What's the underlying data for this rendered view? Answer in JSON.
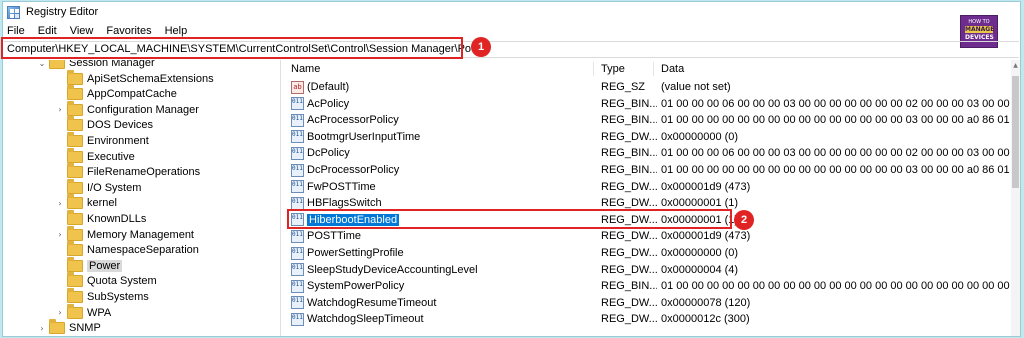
{
  "window": {
    "title": "Registry Editor"
  },
  "menu": [
    "File",
    "Edit",
    "View",
    "Favorites",
    "Help"
  ],
  "address": "Computer\\HKEY_LOCAL_MACHINE\\SYSTEM\\CurrentControlSet\\Control\\Session Manager\\Power",
  "logo": {
    "line1": "HOW TO",
    "line2": "MANAGE",
    "line3": "DEVICES"
  },
  "callouts": [
    "1",
    "2"
  ],
  "tree": [
    {
      "label": "Session Manager",
      "chevron": "⌄",
      "selected": false
    },
    {
      "label": "ApiSetSchemaExtensions",
      "chevron": "",
      "selected": false
    },
    {
      "label": "AppCompatCache",
      "chevron": "",
      "selected": false
    },
    {
      "label": "Configuration Manager",
      "chevron": "›",
      "selected": false
    },
    {
      "label": "DOS Devices",
      "chevron": "",
      "selected": false
    },
    {
      "label": "Environment",
      "chevron": "",
      "selected": false
    },
    {
      "label": "Executive",
      "chevron": "",
      "selected": false
    },
    {
      "label": "FileRenameOperations",
      "chevron": "",
      "selected": false
    },
    {
      "label": "I/O System",
      "chevron": "",
      "selected": false
    },
    {
      "label": "kernel",
      "chevron": "›",
      "selected": false
    },
    {
      "label": "KnownDLLs",
      "chevron": "",
      "selected": false
    },
    {
      "label": "Memory Management",
      "chevron": "›",
      "selected": false
    },
    {
      "label": "NamespaceSeparation",
      "chevron": "",
      "selected": false
    },
    {
      "label": "Power",
      "chevron": "",
      "selected": true
    },
    {
      "label": "Quota System",
      "chevron": "",
      "selected": false
    },
    {
      "label": "SubSystems",
      "chevron": "",
      "selected": false
    },
    {
      "label": "WPA",
      "chevron": "›",
      "selected": false
    },
    {
      "label": "SNMP",
      "chevron": "›",
      "selected": false
    }
  ],
  "columns": {
    "name": "Name",
    "type": "Type",
    "data": "Data"
  },
  "values": [
    {
      "name": "(Default)",
      "type": "REG_SZ",
      "data": "(value not set)",
      "icon": "string-value-icon",
      "selected": false
    },
    {
      "name": "AcPolicy",
      "type": "REG_BIN...",
      "data": "01 00 00 00 06 00 00 00 03 00 00 00 00 00 00 00 02 00 00 00 03 00 00 00 00 00 ...",
      "icon": "binary-value-icon",
      "selected": false
    },
    {
      "name": "AcProcessorPolicy",
      "type": "REG_BIN...",
      "data": "01 00 00 00 00 00 00 00 00 00 00 00 00 00 00 00 03 00 00 00 a0 86 01 00 a0 86 ...",
      "icon": "binary-value-icon",
      "selected": false
    },
    {
      "name": "BootmgrUserInputTime",
      "type": "REG_DW...",
      "data": "0x00000000 (0)",
      "icon": "binary-value-icon",
      "selected": false
    },
    {
      "name": "DcPolicy",
      "type": "REG_BIN...",
      "data": "01 00 00 00 06 00 00 00 03 00 00 00 00 00 00 00 02 00 00 00 03 00 00 00 00 00 ...",
      "icon": "binary-value-icon",
      "selected": false
    },
    {
      "name": "DcProcessorPolicy",
      "type": "REG_BIN...",
      "data": "01 00 00 00 00 00 00 00 00 00 00 00 00 00 00 00 03 00 00 00 a0 86 01 00 a0 86 ...",
      "icon": "binary-value-icon",
      "selected": false
    },
    {
      "name": "FwPOSTTime",
      "type": "REG_DW...",
      "data": "0x000001d9 (473)",
      "icon": "binary-value-icon",
      "selected": false
    },
    {
      "name": "HBFlagsSwitch",
      "type": "REG_DW...",
      "data": "0x00000001 (1)",
      "icon": "binary-value-icon",
      "selected": false
    },
    {
      "name": "HiberbootEnabled",
      "type": "REG_DW...",
      "data": "0x00000001 (1)",
      "icon": "binary-value-icon",
      "selected": true
    },
    {
      "name": "POSTTime",
      "type": "REG_DW...",
      "data": "0x000001d9 (473)",
      "icon": "binary-value-icon",
      "selected": false
    },
    {
      "name": "PowerSettingProfile",
      "type": "REG_DW...",
      "data": "0x00000000 (0)",
      "icon": "binary-value-icon",
      "selected": false
    },
    {
      "name": "SleepStudyDeviceAccountingLevel",
      "type": "REG_DW...",
      "data": "0x00000004 (4)",
      "icon": "binary-value-icon",
      "selected": false
    },
    {
      "name": "SystemPowerPolicy",
      "type": "REG_BIN...",
      "data": "01 00 00 00 00 00 00 00 00 00 00 00 00 00 00 00 00 00 00 00 00 00 00 00 00 00 ...",
      "icon": "binary-value-icon",
      "selected": false
    },
    {
      "name": "WatchdogResumeTimeout",
      "type": "REG_DW...",
      "data": "0x00000078 (120)",
      "icon": "binary-value-icon",
      "selected": false
    },
    {
      "name": "WatchdogSleepTimeout",
      "type": "REG_DW...",
      "data": "0x0000012c (300)",
      "icon": "binary-value-icon",
      "selected": false
    }
  ],
  "colors": {
    "highlight": "#e02424",
    "selection": "#0078d7",
    "background": "#bfe9ef"
  }
}
